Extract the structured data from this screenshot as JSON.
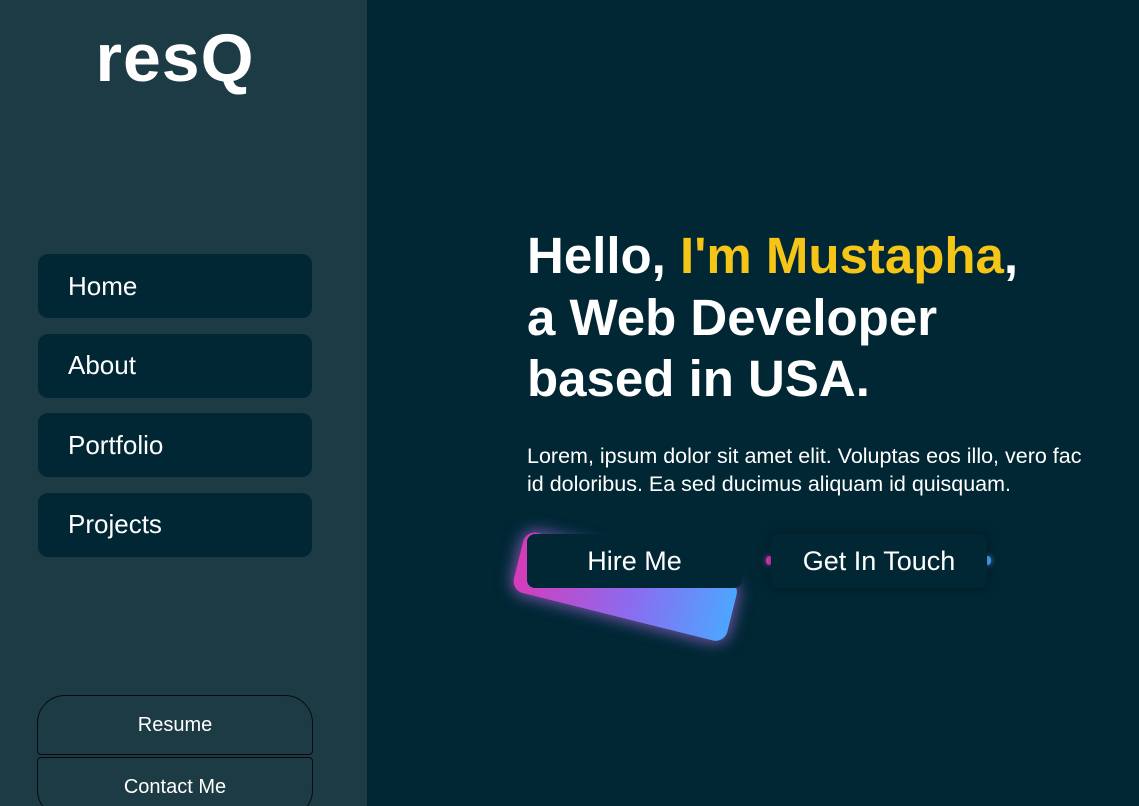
{
  "sidebar": {
    "logo": "resQ",
    "nav": [
      {
        "label": "Home"
      },
      {
        "label": "About"
      },
      {
        "label": "Portfolio"
      },
      {
        "label": "Projects"
      }
    ],
    "resume_label": "Resume",
    "contact_label": "Contact Me"
  },
  "hero": {
    "greeting_prefix": "Hello, ",
    "name": "I'm Mustapha",
    "greeting_suffix": ",",
    "line2": "a Web Developer",
    "line3": "based in USA.",
    "description_line1": "Lorem, ipsum dolor sit amet elit. Voluptas eos illo, vero fac",
    "description_line2": "id doloribus. Ea sed ducimus aliquam id quisquam.",
    "hire_label": "Hire Me",
    "touch_label": "Get In Touch"
  },
  "colors": {
    "background": "#002733",
    "sidebar": "#1c3b44",
    "highlight": "#f5c518",
    "glow_pink": "#d63bb8",
    "glow_blue": "#4da6ff"
  }
}
